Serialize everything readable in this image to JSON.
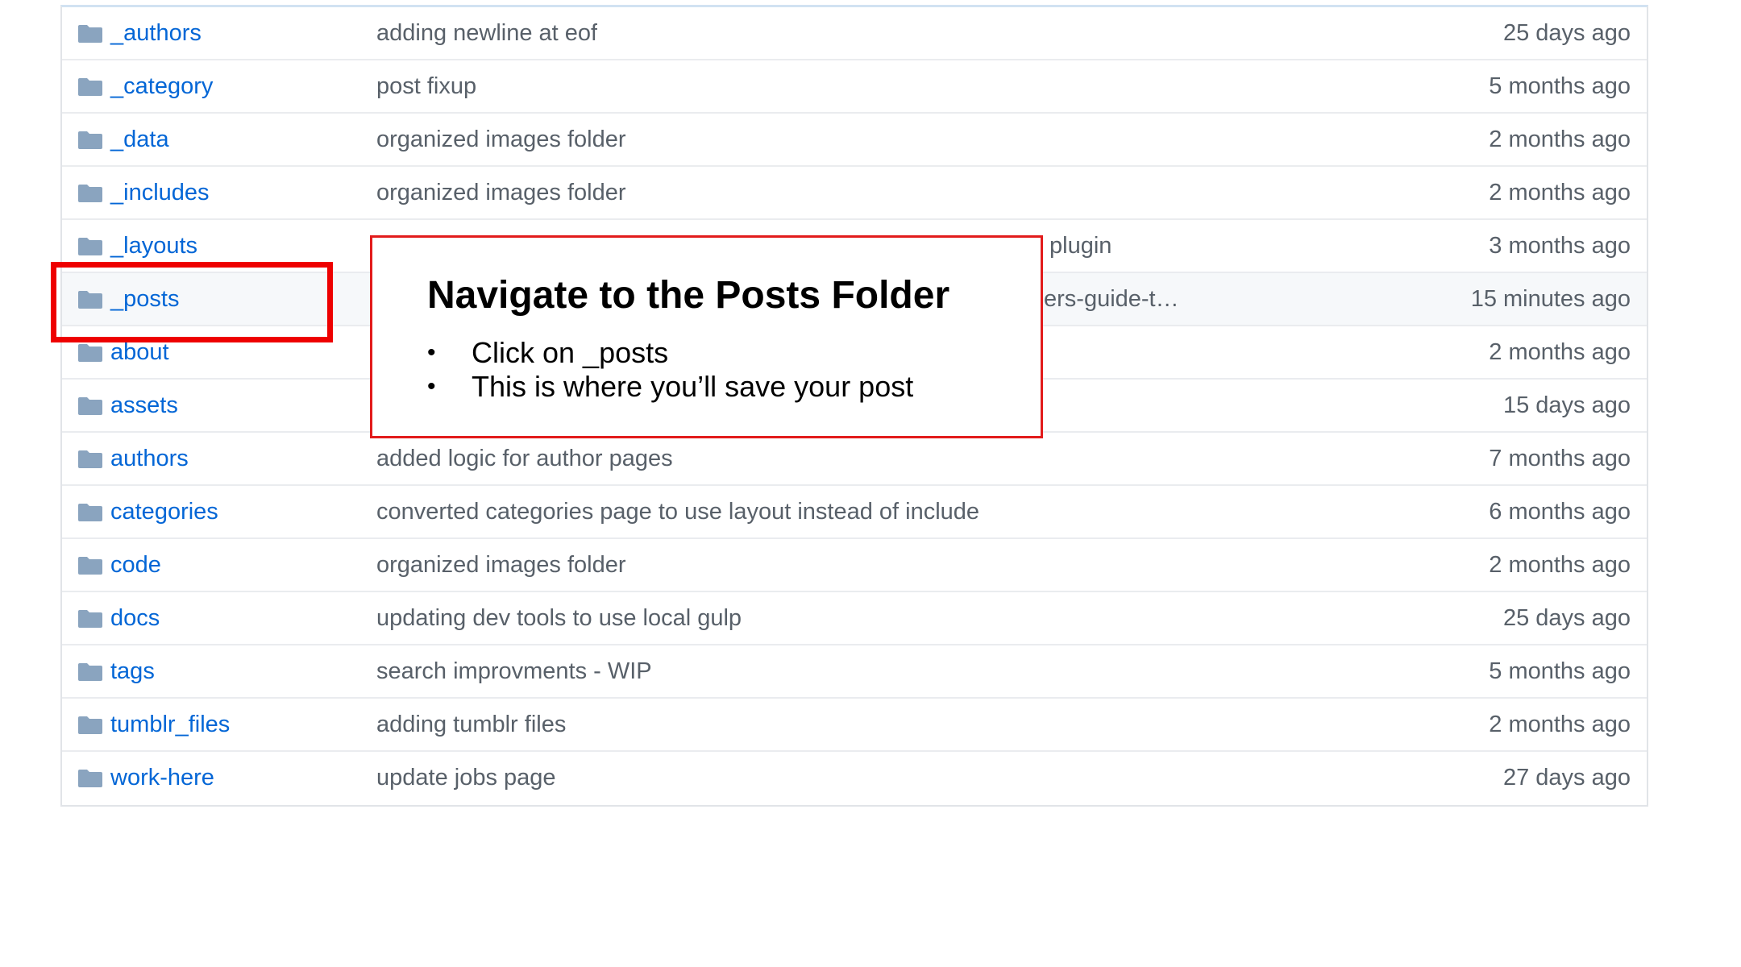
{
  "files": [
    {
      "name": "_authors",
      "message": "adding newline at eof",
      "age": "25 days ago"
    },
    {
      "name": "_category",
      "message": "post fixup",
      "age": "5 months ago"
    },
    {
      "name": "_data",
      "message": "organized images folder",
      "age": "2 months ago"
    },
    {
      "name": "_includes",
      "message": "organized images folder",
      "age": "2 months ago"
    },
    {
      "name": "_layouts",
      "message": "plugin",
      "age": "3 months ago"
    },
    {
      "name": "_posts",
      "message": "ers-guide-t…",
      "age": "15 minutes ago"
    },
    {
      "name": "about",
      "message": "",
      "age": "2 months ago"
    },
    {
      "name": "assets",
      "message": "",
      "age": "15 days ago"
    },
    {
      "name": "authors",
      "message": "added logic for author pages",
      "age": "7 months ago"
    },
    {
      "name": "categories",
      "message": "converted categories page to use layout instead of include",
      "age": "6 months ago"
    },
    {
      "name": "code",
      "message": "organized images folder",
      "age": "2 months ago"
    },
    {
      "name": "docs",
      "message": "updating dev tools to use local gulp",
      "age": "25 days ago"
    },
    {
      "name": "tags",
      "message": "search improvments - WIP",
      "age": "5 months ago"
    },
    {
      "name": "tumblr_files",
      "message": "adding tumblr files",
      "age": "2 months ago"
    },
    {
      "name": "work-here",
      "message": "update jobs page",
      "age": "27 days ago"
    }
  ],
  "callout": {
    "title": "Navigate to the Posts Folder",
    "bullets": [
      "Click on _posts",
      "This is where you’ll save your post"
    ],
    "bullet_glyph": "•"
  },
  "colors": {
    "link": "#0366d6",
    "muted": "#586069",
    "folder_icon": "#79b8ff",
    "highlight": "#ee0000"
  },
  "icons": {
    "row_icon": "folder-icon"
  }
}
